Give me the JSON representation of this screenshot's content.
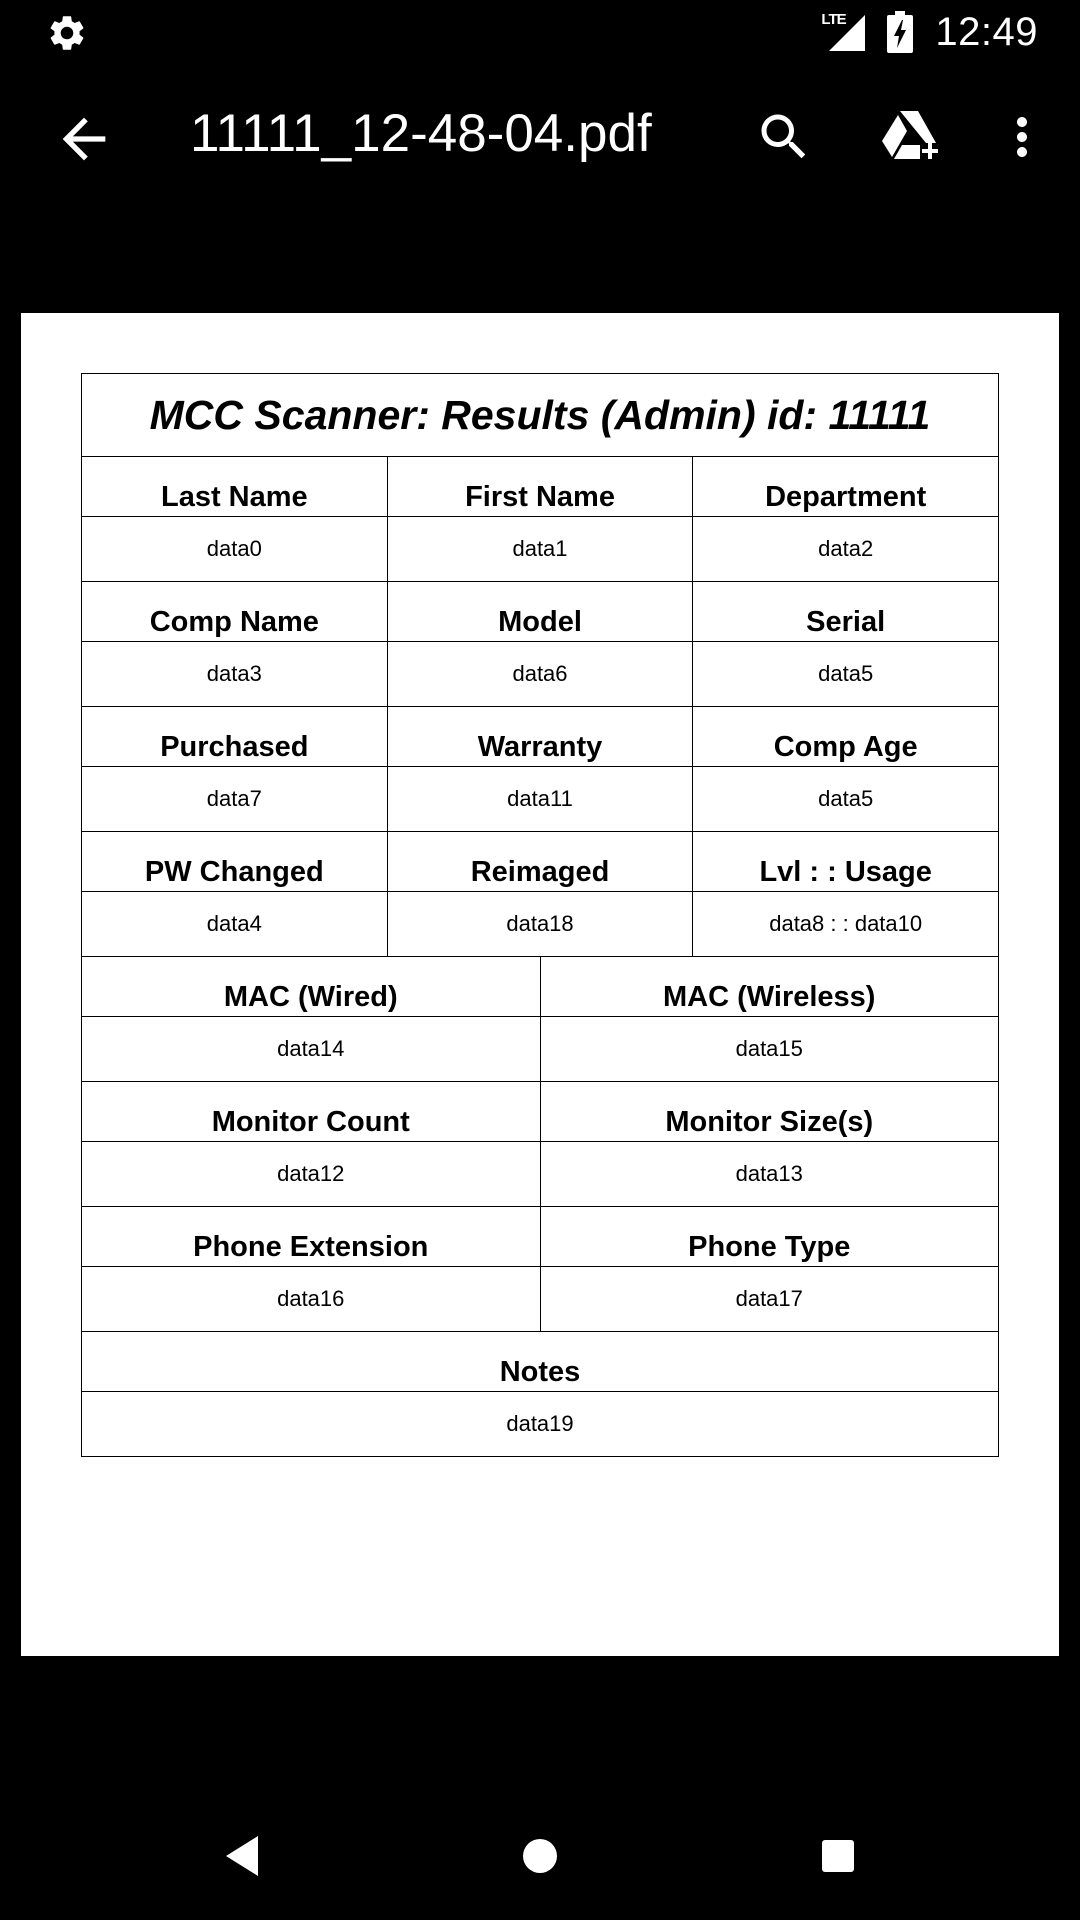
{
  "status_bar": {
    "network": "LTE",
    "time": "12:49"
  },
  "toolbar": {
    "title": "11111_12-48-04.pdf"
  },
  "document": {
    "title": "MCC Scanner: Results (Admin) id: 11111",
    "rows": [
      {
        "headers": [
          "Last Name",
          "First Name",
          "Department"
        ],
        "values": [
          "data0",
          "data1",
          "data2"
        ]
      },
      {
        "headers": [
          "Comp Name",
          "Model",
          "Serial"
        ],
        "values": [
          "data3",
          "data6",
          "data5"
        ]
      },
      {
        "headers": [
          "Purchased",
          "Warranty",
          "Comp Age"
        ],
        "values": [
          "data7",
          "data11",
          "data5"
        ]
      },
      {
        "headers": [
          "PW Changed",
          "Reimaged",
          "Lvl : : Usage"
        ],
        "values": [
          "data4",
          "data18",
          "data8 : : data10"
        ]
      },
      {
        "headers": [
          "MAC (Wired)",
          "MAC (Wireless)"
        ],
        "values": [
          "data14",
          "data15"
        ]
      },
      {
        "headers": [
          "Monitor Count",
          "Monitor Size(s)"
        ],
        "values": [
          "data12",
          "data13"
        ]
      },
      {
        "headers": [
          "Phone Extension",
          "Phone Type"
        ],
        "values": [
          "data16",
          "data17"
        ]
      },
      {
        "headers": [
          "Notes"
        ],
        "values": [
          "data19"
        ]
      }
    ]
  },
  "colors": {
    "chrome_background": "#000000",
    "page_background": "#ffffff",
    "text": "#000000"
  },
  "icons": {
    "status_left": "gear-icon",
    "toolbar": [
      "back-arrow-icon",
      "search-icon",
      "drive-add-icon",
      "more-vert-icon"
    ],
    "nav": [
      "nav-back-icon",
      "nav-home-icon",
      "nav-recents-icon"
    ]
  }
}
